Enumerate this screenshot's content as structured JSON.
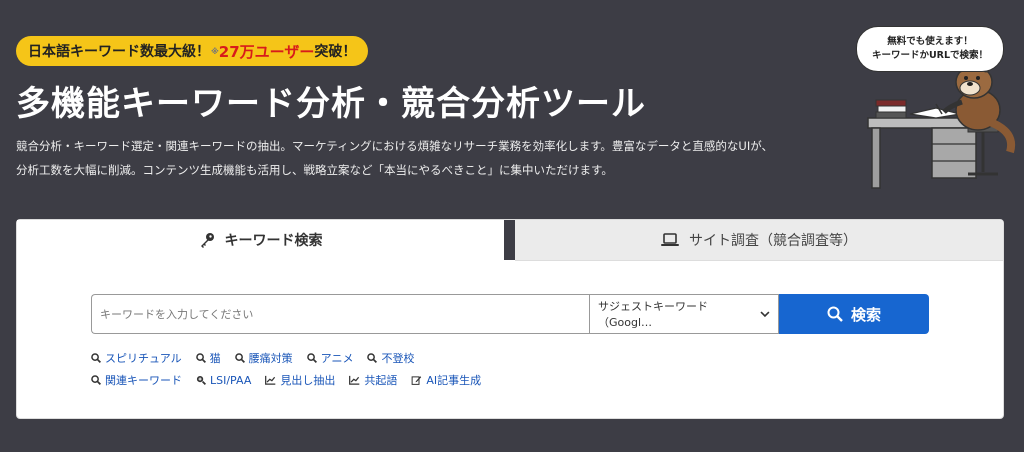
{
  "hero": {
    "badge_prefix": "日本語キーワード数最大級！",
    "badge_note": "※",
    "badge_highlight": "27万ユーザー",
    "badge_suffix": "突破！",
    "title": "多機能キーワード分析・競合分析ツール",
    "desc_line1": "競合分析・キーワード選定・関連キーワードの抽出。マーケティングにおける煩雑なリサーチ業務を効率化します。豊富なデータと直感的なUIが、",
    "desc_line2": "分析工数を大幅に削減。コンテンツ生成機能も活用し、戦略立案など「本当にやるべきこと」に集中いただけます。"
  },
  "bubble": {
    "line1": "無料でも使えます！",
    "line2": "キーワードかURLで検索！"
  },
  "tabs": [
    {
      "label": "キーワード検索",
      "icon": "key-icon",
      "active": true
    },
    {
      "label": "サイト調査（競合調査等）",
      "icon": "laptop-icon",
      "active": false
    }
  ],
  "search": {
    "placeholder": "キーワードを入力してください",
    "value": "",
    "select_value": "サジェストキーワード（Googl…",
    "button_label": "検索"
  },
  "suggestions": [
    "スピリチュアル",
    "猫",
    "腰痛対策",
    "アニメ",
    "不登校"
  ],
  "tools": [
    {
      "label": "関連キーワード",
      "icon": "search-icon"
    },
    {
      "label": "LSI/PAA",
      "icon": "search-plus-icon"
    },
    {
      "label": "見出し抽出",
      "icon": "chart-icon"
    },
    {
      "label": "共起語",
      "icon": "chart-icon"
    },
    {
      "label": "AI記事生成",
      "icon": "edit-icon"
    }
  ],
  "colors": {
    "background": "#3d3d45",
    "badge": "#f5c518",
    "highlight": "#d81b1b",
    "accent": "#1766d0",
    "link": "#1a56b8"
  }
}
